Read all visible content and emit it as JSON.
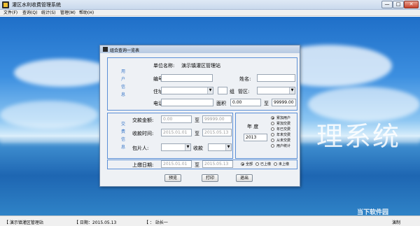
{
  "window": {
    "title": "灌区水利收费管理系统",
    "btn_min": "—",
    "btn_max": "□",
    "btn_close": "✕"
  },
  "menu": [
    {
      "label": "文件(F)"
    },
    {
      "label": "查询(Q)"
    },
    {
      "label": "统计(S)"
    },
    {
      "label": "管理(M)"
    },
    {
      "label": "帮助(H)"
    }
  ],
  "background": {
    "title_text": "理系统",
    "watermark": "当下软件园"
  },
  "dialog": {
    "title": "组合查询一览表",
    "user_group_label": [
      "用",
      "户",
      "信",
      "息"
    ],
    "unit_name_label": "单位名称:",
    "unit_name_value": "演示镇灌区管理站",
    "number_label": "编号:",
    "name_label": "姓名:",
    "address_label": "住址:",
    "group_label": "组",
    "district_label": "管区:",
    "phone_label": "电话:",
    "area_label": "面积",
    "area_from": "0.00",
    "area_to_label": "至",
    "area_to": "99999.00",
    "trade_group_label": [
      "交",
      "费",
      "信",
      "息"
    ],
    "amount_label": "交款金额:",
    "amount_from": "0.00",
    "amount_to_label": "至",
    "amount_to": "99999.00",
    "date_label": "收款时间:",
    "date_from": "2015.01.01",
    "date_to_label": "至",
    "date_to": "2015.05.13",
    "contractor_label": "包片人:",
    "collector_label": "收款",
    "year_label": "年  度",
    "year_value": "2013",
    "report_options": [
      {
        "label": "累加用户",
        "selected": true
      },
      {
        "label": "累加交费",
        "selected": false
      },
      {
        "label": "年已交费",
        "selected": false
      },
      {
        "label": "年未交费",
        "selected": false
      },
      {
        "label": "从未交费",
        "selected": false
      },
      {
        "label": "用户统计",
        "selected": false
      }
    ],
    "submit_date_label": "上缴日期:",
    "submit_from": "2015.01.01",
    "submit_to_label": "至",
    "submit_to": "2015.05.13",
    "submit_options": [
      {
        "label": "全部",
        "selected": true
      },
      {
        "label": "已上缴",
        "selected": false
      },
      {
        "label": "未上缴",
        "selected": false
      }
    ],
    "btn_search": "预览",
    "btn_print": "打印",
    "btn_exit": "退出"
  },
  "status": {
    "unit": "【 演示镇灌区管理站",
    "date": "【 日期：2015.05.13",
    "user": "【  ：  站长一",
    "right": "演制"
  }
}
